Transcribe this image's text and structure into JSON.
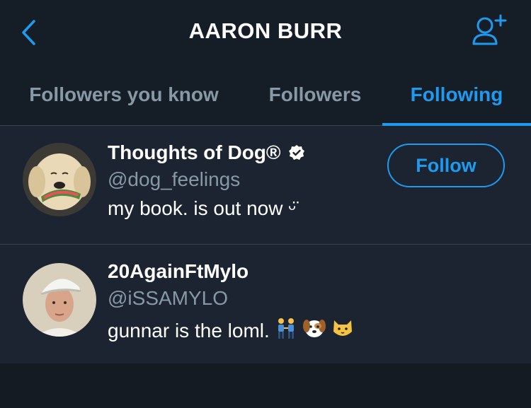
{
  "header": {
    "title": "AARON BURR",
    "back_icon": "chevron-left-icon",
    "add_user_icon": "add-user-icon"
  },
  "tabs": [
    {
      "label": "Followers you know",
      "active": false
    },
    {
      "label": "Followers",
      "active": false
    },
    {
      "label": "Following",
      "active": true
    }
  ],
  "users": [
    {
      "name": "Thoughts of Dog®",
      "verified": true,
      "handle": "@dog_feelings",
      "bio": "my book. is out now ᵕ̈",
      "follow_label": "Follow"
    },
    {
      "name": "20AgainFtMylo",
      "verified": false,
      "handle": "@iSSAMYLO",
      "bio": "gunnar is the loml.",
      "bio_emoji": [
        "two-men-holding-hands-emoji",
        "dog-face-emoji",
        "cat-face-emoji"
      ]
    }
  ],
  "colors": {
    "accent": "#1d9bf0",
    "background": "#1b2430",
    "header_bg": "#151d27",
    "muted_text": "#8899a6"
  }
}
